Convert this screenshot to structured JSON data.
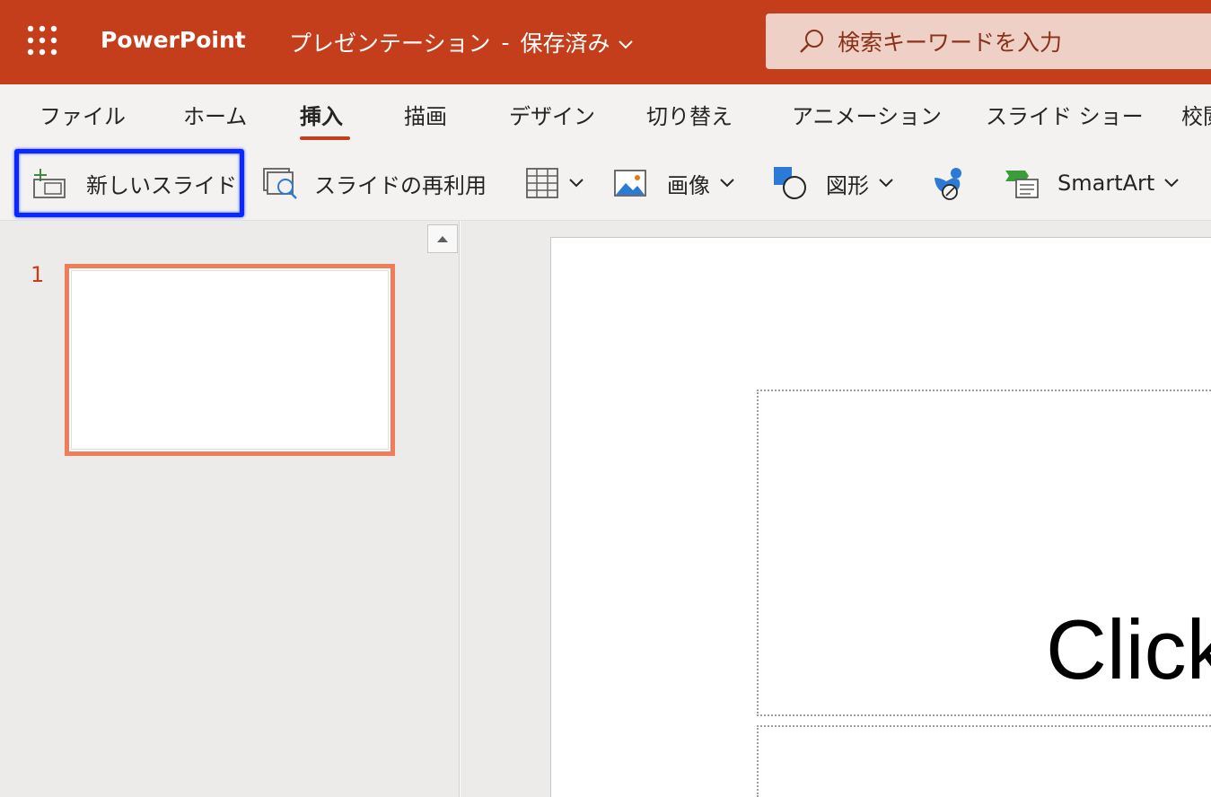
{
  "app": {
    "name": "PowerPoint",
    "document_title": "プレゼンテーション",
    "separator": "-",
    "save_status": "保存済み",
    "brand_color": "#c43e1c"
  },
  "search": {
    "placeholder": "検索キーワードを入力",
    "icon": "search-icon"
  },
  "tabs": [
    {
      "label": "ファイル"
    },
    {
      "label": "ホーム"
    },
    {
      "label": "挿入",
      "active": true
    },
    {
      "label": "描画"
    },
    {
      "label": "デザイン"
    },
    {
      "label": "切り替え"
    },
    {
      "label": "アニメーション"
    },
    {
      "label": "スライド ショー"
    },
    {
      "label": "校閲"
    }
  ],
  "commands": {
    "new_slide": "新しいスライド",
    "reuse_slide": "スライドの再利用",
    "table": "",
    "image": "画像",
    "shapes": "図形",
    "icons": "",
    "smartart": "SmartArt"
  },
  "thumbnails": {
    "items": [
      {
        "number": "1"
      }
    ]
  },
  "slide": {
    "title_placeholder": "Click"
  },
  "colors": {
    "highlight": "#0a28ff",
    "selected_thumb": "#f07c5a"
  }
}
